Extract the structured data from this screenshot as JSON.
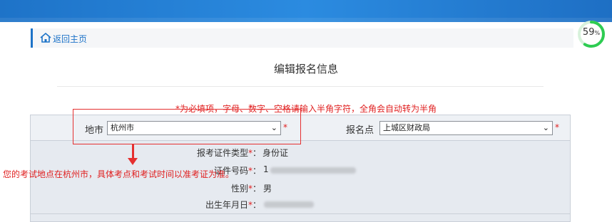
{
  "breadcrumb": {
    "home_label": "返回主页"
  },
  "progress": {
    "value": "59",
    "unit": "%",
    "fraction": 0.59,
    "color": "#2ecc52"
  },
  "page": {
    "title": "编辑报名信息"
  },
  "notice": "*为必填项，字母、数字、空格请输入半角字符，全角会自动转为半角",
  "form": {
    "city_label": "地市",
    "city_value": "杭州市",
    "site_label": "报名点",
    "site_value": "上城区财政局",
    "required_mark": "*",
    "id_type_label": "报考证件类型",
    "id_type_value": "身份证",
    "id_number_label": "证件号码",
    "id_number_prefix": "1",
    "gender_label": "性别",
    "gender_value": "男",
    "birth_label": "出生年月日",
    "colon": "："
  },
  "annotation": "您的考试地点在杭州市，具体考点和考试时间以准考证为准。",
  "colors": {
    "accent": "#1d73c8",
    "alert": "#e02020"
  }
}
